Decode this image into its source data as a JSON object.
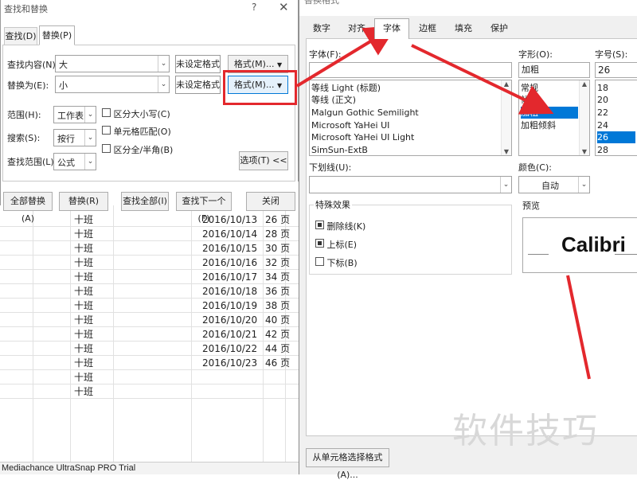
{
  "sheet": {
    "rows": [
      {
        "ban": "十班",
        "date": "2016/10/13",
        "page": "26 页"
      },
      {
        "ban": "十班",
        "date": "2016/10/14",
        "page": "28 页"
      },
      {
        "ban": "十班",
        "date": "2016/10/15",
        "page": "30 页"
      },
      {
        "ban": "十班",
        "date": "2016/10/16",
        "page": "32 页"
      },
      {
        "ban": "十班",
        "date": "2016/10/17",
        "page": "34 页"
      },
      {
        "ban": "十班",
        "date": "2016/10/18",
        "page": "36 页"
      },
      {
        "ban": "十班",
        "date": "2016/10/19",
        "page": "38 页"
      },
      {
        "ban": "十班",
        "date": "2016/10/20",
        "page": "40 页"
      },
      {
        "ban": "十班",
        "date": "2016/10/21",
        "page": "42 页"
      },
      {
        "ban": "十班",
        "date": "2016/10/22",
        "page": "44 页"
      },
      {
        "ban": "十班",
        "date": "2016/10/23",
        "page": "46 页"
      },
      {
        "ban": "十班",
        "date": "",
        "page": ""
      },
      {
        "ban": "十班",
        "date": "",
        "page": ""
      }
    ],
    "status": "Mediachance UltraSnap PRO Trial"
  },
  "find_replace": {
    "title": "查找和替换",
    "help": "?",
    "close": "✕",
    "tabs": {
      "find": "查找(D)",
      "replace": "替换(P)"
    },
    "find_label": "查找内容(N):",
    "find_value": "大",
    "replace_label": "替换为(E):",
    "replace_value": "小",
    "not_set_1": "未设定格式",
    "not_set_2": "未设定格式",
    "format_btn_1": "格式(M)...",
    "format_btn_2": "格式(M)...",
    "within_label": "范围(H):",
    "within_value": "工作表",
    "search_label": "搜索(S):",
    "search_value": "按行",
    "lookin_label": "查找范围(L):",
    "lookin_value": "公式",
    "match_case": "区分大小写(C)",
    "match_cell": "单元格匹配(O)",
    "match_width": "区分全/半角(B)",
    "options_btn": "选项(T) <<",
    "buttons": {
      "replace_all": "全部替换(A)",
      "replace": "替换(R)",
      "find_all": "查找全部(I)",
      "find_next": "查找下一个(F)",
      "close": "关闭"
    }
  },
  "format": {
    "title": "替换格式",
    "tabs": [
      "数字",
      "对齐",
      "字体",
      "边框",
      "填充",
      "保护"
    ],
    "active_tab": "字体",
    "font_label": "字体(F):",
    "font_list": [
      "等线 Light (标题)",
      "等线 (正文)",
      "Malgun Gothic Semilight",
      "Microsoft YaHei UI",
      "Microsoft YaHei UI Light",
      "SimSun-ExtB"
    ],
    "style_label": "字形(O):",
    "style_value": "加粗",
    "style_list": [
      "常规",
      "倾斜",
      "加粗",
      "加粗倾斜"
    ],
    "style_selected": 2,
    "size_label": "字号(S):",
    "size_value": "26",
    "size_list": [
      "18",
      "20",
      "22",
      "24",
      "26",
      "28"
    ],
    "size_selected": 4,
    "underline_label": "下划线(U):",
    "color_label": "颜色(C):",
    "color_value": "自动",
    "effects_title": "特殊效果",
    "effects": [
      {
        "label": "删除线(K)",
        "checked": true
      },
      {
        "label": "上标(E)",
        "checked": true
      },
      {
        "label": "下标(B)",
        "checked": false
      }
    ],
    "preview_label": "预览",
    "preview_text": "Calibri",
    "from_cell_btn": "从单元格选择格式(A)..."
  },
  "watermark": "软件技巧",
  "colors": {
    "annotation": "#e3282d",
    "selection": "#0078d7"
  }
}
